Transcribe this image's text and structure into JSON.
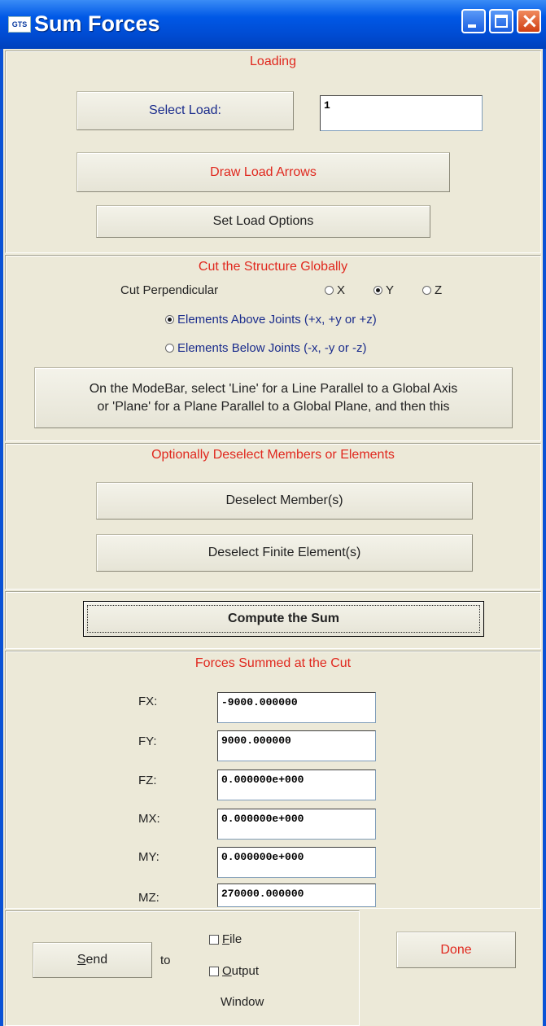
{
  "window": {
    "title": "Sum Forces",
    "icon": "GTS"
  },
  "loading": {
    "heading": "Loading",
    "select_load_label": "Select Load:",
    "load_value": "1",
    "draw_arrows_label": "Draw Load Arrows",
    "set_options_label": "Set Load Options"
  },
  "cut": {
    "heading": "Cut the Structure Globally",
    "perp_label": "Cut Perpendicular",
    "axes": [
      {
        "label": "X",
        "selected": false
      },
      {
        "label": "Y",
        "selected": true
      },
      {
        "label": "Z",
        "selected": false
      }
    ],
    "above_label": "Elements Above Joints (+x, +y or +z)",
    "below_label": "Elements Below Joints (-x, -y or -z)",
    "above_selected": true,
    "mode_line1": "On the ModeBar, select 'Line' for a Line Parallel to a Global Axis",
    "mode_line2": "or 'Plane' for a Plane Parallel to a Global Plane, and then this"
  },
  "deselect": {
    "heading": "Optionally Deselect Members or Elements",
    "members_label": "Deselect Member(s)",
    "elements_label": "Deselect Finite Element(s)"
  },
  "compute": {
    "label": "Compute the Sum"
  },
  "results": {
    "heading": "Forces Summed at the Cut",
    "rows": [
      {
        "label": "FX:",
        "value": "-9000.000000"
      },
      {
        "label": "FY:",
        "value": "9000.000000"
      },
      {
        "label": "FZ:",
        "value": "0.000000e+000"
      },
      {
        "label": "MX:",
        "value": "0.000000e+000"
      },
      {
        "label": "MY:",
        "value": "0.000000e+000"
      },
      {
        "label": "MZ:",
        "value": "270000.000000"
      }
    ]
  },
  "footer": {
    "send_label": "Send",
    "send_mnemonic": "S",
    "send_rest": "end",
    "to_label": "to",
    "file_label": "File",
    "file_mnemonic": "F",
    "file_rest": "ile",
    "output_mnemonic": "O",
    "output_rest": "utput",
    "window_label": "Window",
    "done_label": "Done"
  }
}
